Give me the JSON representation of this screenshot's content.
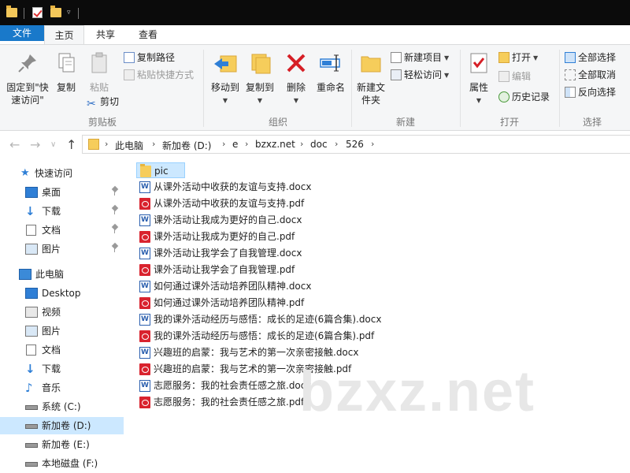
{
  "ribbon_tabs": [
    "文件",
    "主页",
    "共享",
    "查看"
  ],
  "clipboard": {
    "pin_label": "固定到\"快速访问\"",
    "copy_label": "复制",
    "paste_label": "粘贴",
    "copy_path_label": "复制路径",
    "paste_shortcut_label": "粘贴快捷方式",
    "cut_label": "剪切",
    "group_label": "剪贴板"
  },
  "organize": {
    "move_to_label": "移动到",
    "copy_to_label": "复制到",
    "delete_label": "删除",
    "rename_label": "重命名",
    "group_label": "组织"
  },
  "new_group": {
    "new_folder_label": "新建文件夹",
    "new_item_label": "新建项目",
    "easy_access_label": "轻松访问",
    "group_label": "新建"
  },
  "open_group": {
    "properties_label": "属性",
    "open_label": "打开",
    "edit_label": "编辑",
    "history_label": "历史记录",
    "group_label": "打开"
  },
  "select_group": {
    "select_all_label": "全部选择",
    "select_none_label": "全部取消",
    "invert_label": "反向选择",
    "group_label": "选择"
  },
  "address": {
    "crumbs": [
      "此电脑",
      "新加卷 (D:)",
      "e",
      "bzxz.net",
      "doc",
      "526"
    ]
  },
  "nav": {
    "quick_access": "快速访问",
    "qa_items": [
      "桌面",
      "下载",
      "文档",
      "图片"
    ],
    "this_pc": "此电脑",
    "pc_items": [
      "Desktop",
      "视频",
      "图片",
      "文档",
      "下载",
      "音乐",
      "系统 (C:)",
      "新加卷 (D:)",
      "新加卷 (E:)",
      "本地磁盘 (F:)"
    ]
  },
  "files": [
    {
      "name": "pic",
      "type": "folder"
    },
    {
      "name": "从课外活动中收获的友谊与支持.docx",
      "type": "docx"
    },
    {
      "name": "从课外活动中收获的友谊与支持.pdf",
      "type": "pdf"
    },
    {
      "name": "课外活动让我成为更好的自己.docx",
      "type": "docx"
    },
    {
      "name": "课外活动让我成为更好的自己.pdf",
      "type": "pdf"
    },
    {
      "name": "课外活动让我学会了自我管理.docx",
      "type": "docx"
    },
    {
      "name": "课外活动让我学会了自我管理.pdf",
      "type": "pdf"
    },
    {
      "name": "如何通过课外活动培养团队精神.docx",
      "type": "docx"
    },
    {
      "name": "如何通过课外活动培养团队精神.pdf",
      "type": "pdf"
    },
    {
      "name": "我的课外活动经历与感悟：成长的足迹(6篇合集).docx",
      "type": "docx"
    },
    {
      "name": "我的课外活动经历与感悟：成长的足迹(6篇合集).pdf",
      "type": "pdf"
    },
    {
      "name": "兴趣班的启蒙：我与艺术的第一次亲密接触.docx",
      "type": "docx"
    },
    {
      "name": "兴趣班的启蒙：我与艺术的第一次亲密接触.pdf",
      "type": "pdf"
    },
    {
      "name": "志愿服务：我的社会责任感之旅.docx",
      "type": "docx"
    },
    {
      "name": "志愿服务：我的社会责任感之旅.pdf",
      "type": "pdf"
    }
  ],
  "watermark": "bzxz.net"
}
